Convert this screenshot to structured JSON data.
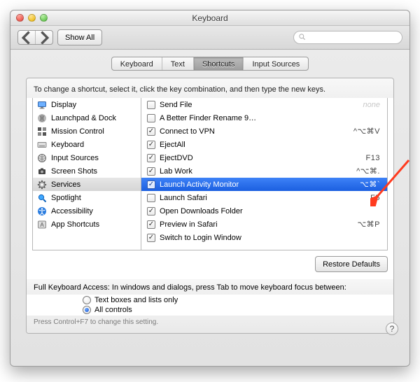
{
  "window": {
    "title": "Keyboard"
  },
  "toolbar": {
    "show_all": "Show All",
    "search_placeholder": ""
  },
  "tabs": [
    "Keyboard",
    "Text",
    "Shortcuts",
    "Input Sources"
  ],
  "tabs_active_index": 2,
  "instruction": "To change a shortcut, select it, click the key combination, and then type the new keys.",
  "left_panel": {
    "selected_index": 6,
    "items": [
      {
        "label": "Display",
        "icon": "display-icon"
      },
      {
        "label": "Launchpad & Dock",
        "icon": "launchpad-icon"
      },
      {
        "label": "Mission Control",
        "icon": "mission-control-icon"
      },
      {
        "label": "Keyboard",
        "icon": "keyboard-icon"
      },
      {
        "label": "Input Sources",
        "icon": "globe-icon"
      },
      {
        "label": "Screen Shots",
        "icon": "screenshots-icon"
      },
      {
        "label": "Services",
        "icon": "gear-icon"
      },
      {
        "label": "Spotlight",
        "icon": "spotlight-icon"
      },
      {
        "label": "Accessibility",
        "icon": "accessibility-icon"
      },
      {
        "label": "App Shortcuts",
        "icon": "app-shortcuts-icon"
      }
    ]
  },
  "right_panel": {
    "selected_index": 6,
    "items": [
      {
        "checked": false,
        "name": "Send File",
        "shortcut": "",
        "none": true
      },
      {
        "checked": false,
        "name": "A Better Finder Rename 9…",
        "shortcut": ""
      },
      {
        "checked": true,
        "name": "Connect to VPN",
        "shortcut": "^⌥⌘V"
      },
      {
        "checked": true,
        "name": "EjectAll",
        "shortcut": ""
      },
      {
        "checked": true,
        "name": "EjectDVD",
        "shortcut": "F13"
      },
      {
        "checked": true,
        "name": "Lab Work",
        "shortcut": "^⌥⌘."
      },
      {
        "checked": true,
        "name": "Launch Activity Monitor",
        "shortcut": "⌥⌘`"
      },
      {
        "checked": false,
        "name": "Launch Safari",
        "shortcut": "F5"
      },
      {
        "checked": true,
        "name": "Open Downloads Folder",
        "shortcut": ""
      },
      {
        "checked": true,
        "name": "Preview in Safari",
        "shortcut": "⌥⌘P"
      },
      {
        "checked": true,
        "name": "Switch to Login Window",
        "shortcut": ""
      }
    ]
  },
  "restore_defaults": "Restore Defaults",
  "fka": {
    "label": "Full Keyboard Access: In windows and dialogs, press Tab to move keyboard focus between:",
    "opt1": "Text boxes and lists only",
    "opt2": "All controls",
    "selected": 1,
    "hint": "Press Control+F7 to change this setting."
  }
}
